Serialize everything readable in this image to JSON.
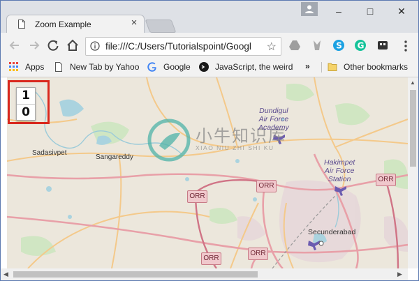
{
  "tab": {
    "title": "Zoom Example",
    "close_glyph": "×"
  },
  "window_controls": {
    "minimize": "–",
    "maximize": "□",
    "close": "✕"
  },
  "address_bar": {
    "url": "file:///C:/Users/Tutorialspoint/Googl"
  },
  "bookmarks": [
    {
      "label": "Apps",
      "icon": "apps-grid-icon"
    },
    {
      "label": "New Tab by Yahoo",
      "icon": "page-icon"
    },
    {
      "label": "Google",
      "icon": "google-icon"
    },
    {
      "label": "JavaScript, the weird",
      "icon": "js-icon"
    },
    {
      "label": "»",
      "icon": ""
    },
    {
      "label": "Other bookmarks",
      "icon": "folder-icon"
    }
  ],
  "zoom": {
    "in_label": "1",
    "out_label": "0"
  },
  "map": {
    "labels": {
      "sadasivpet": "Sadasivpet",
      "sangareddy": "Sangareddy",
      "secunderabad": "Secunderabad"
    },
    "dundigul": [
      "Dundigul",
      "Air Force",
      "Academy"
    ],
    "hakimpet": [
      "Hakimpet",
      "Air Force",
      "Station"
    ],
    "orr_label": "ORR"
  },
  "watermark": {
    "text": "小牛知识库",
    "sub": "XIAO NIU ZHI SHI KU"
  },
  "colors": {
    "map_bg": "#ece7dc",
    "zoom_highlight": "#d9281e",
    "road_primary": "#e8a0a8",
    "road_secondary": "#f4c98a"
  }
}
